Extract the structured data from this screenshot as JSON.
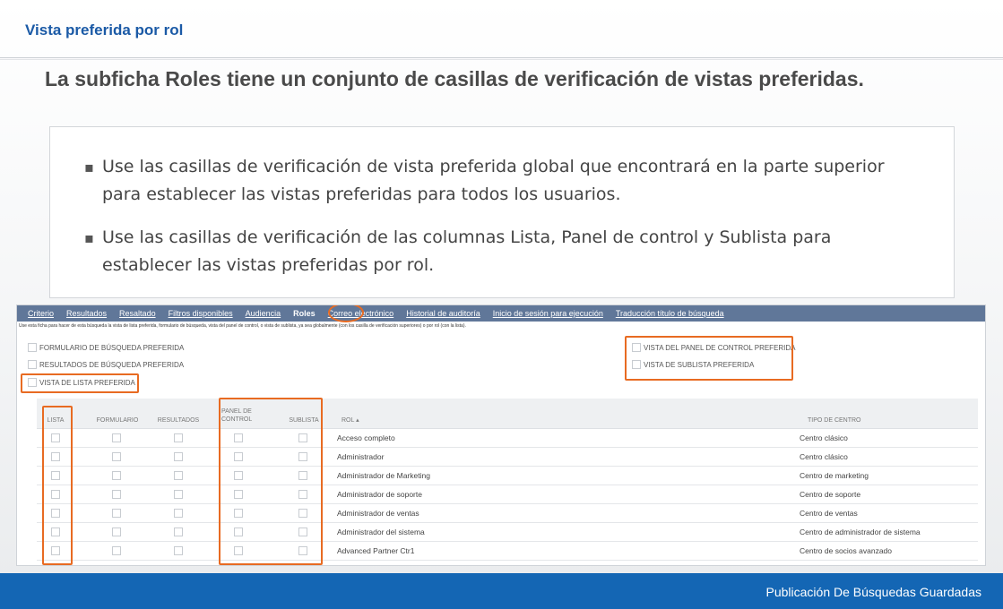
{
  "slide": {
    "title": "Vista preferida por rol",
    "headline": "La subficha Roles tiene un conjunto de casillas de verificación de vistas preferidas.",
    "bullets": [
      "Use las casillas de verificación de vista preferida global que encontrará en la parte superior para establecer las vistas preferidas para todos los usuarios.",
      "Use las casillas de verificación de las columnas Lista, Panel de control y Sublista para establecer las vistas preferidas por rol."
    ],
    "footer": "Publicación De Búsquedas Guardadas"
  },
  "tabs": [
    "Criterio",
    "Resultados",
    "Resaltado",
    "Filtros disponibles",
    "Audiencia",
    "Roles",
    "Correo electrónico",
    "Historial de auditoría",
    "Inicio de sesión para ejecución",
    "Traducción título de búsqueda"
  ],
  "active_tab": "Roles",
  "note": "Use esta ficha para hacer de esta búsqueda la vista de lista preferida, formulario de búsqueda, vista del panel de control, o vista de sublista, ya sea globalmente (con los casilla de verificación superiores) o por rol (con la lista).",
  "global_options": {
    "search_form": "FORMULARIO DE BÚSQUEDA PREFERIDA",
    "search_results": "RESULTADOS DE BÚSQUEDA PREFERIDA",
    "list_view": "VISTA DE LISTA PREFERIDA",
    "dashboard_view": "VISTA DEL PANEL DE CONTROL PREFERIDA",
    "sublist_view": "VISTA DE SUBLISTA PREFERIDA"
  },
  "columns": {
    "lista": "LISTA",
    "formulario": "FORMULARIO",
    "resultados": "RESULTADOS",
    "panel": "PANEL DE CONTROL",
    "sublista": "SUBLISTA",
    "rol": "ROL ▴",
    "tipo_centro": "TIPO DE CENTRO"
  },
  "rows": [
    {
      "rol": "Acceso completo",
      "centro": "Centro clásico"
    },
    {
      "rol": "Administrador",
      "centro": "Centro clásico"
    },
    {
      "rol": "Administrador de Marketing",
      "centro": "Centro de marketing"
    },
    {
      "rol": "Administrador de soporte",
      "centro": "Centro de soporte"
    },
    {
      "rol": "Administrador de ventas",
      "centro": "Centro de ventas"
    },
    {
      "rol": "Administrador del sistema",
      "centro": "Centro de administrador de sistema"
    },
    {
      "rol": "Advanced Partner Ctr1",
      "centro": "Centro de socios avanzado"
    }
  ],
  "colors": {
    "title_blue": "#1b5aa6",
    "tabbar": "#607799",
    "highlight": "#e86b22",
    "footer": "#1466b4"
  }
}
